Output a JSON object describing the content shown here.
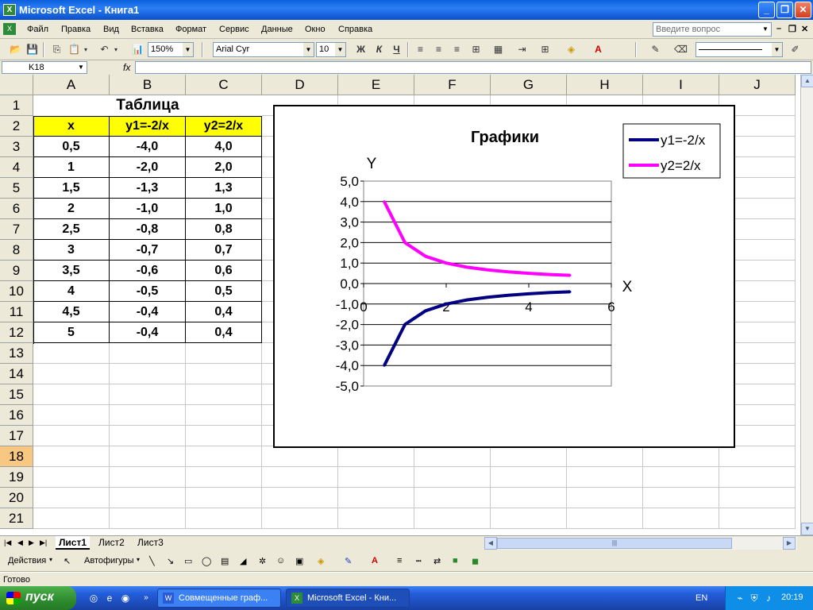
{
  "window": {
    "title": "Microsoft Excel - Книга1"
  },
  "menu": {
    "items": [
      "Файл",
      "Правка",
      "Вид",
      "Вставка",
      "Формат",
      "Сервис",
      "Данные",
      "Окно",
      "Справка"
    ],
    "ask_placeholder": "Введите вопрос"
  },
  "toolbar": {
    "zoom": "150%",
    "font": "Arial Cyr",
    "size": "10",
    "bold": "Ж",
    "italic": "К",
    "underline": "Ч"
  },
  "formula": {
    "namebox": "K18",
    "fx": "fx",
    "value": ""
  },
  "grid": {
    "columns": [
      "A",
      "B",
      "C",
      "D",
      "E",
      "F",
      "G",
      "H",
      "I",
      "J"
    ],
    "rows": [
      "1",
      "2",
      "3",
      "4",
      "5",
      "6",
      "7",
      "8",
      "9",
      "10",
      "11",
      "12",
      "13",
      "14",
      "15",
      "16",
      "17",
      "18",
      "19",
      "20",
      "21"
    ],
    "selected_row": "18",
    "table_title": "Таблица",
    "headers": [
      "x",
      "y1=-2/x",
      "y2=2/x"
    ],
    "data": [
      [
        "0,5",
        "-4,0",
        "4,0"
      ],
      [
        "1",
        "-2,0",
        "2,0"
      ],
      [
        "1,5",
        "-1,3",
        "1,3"
      ],
      [
        "2",
        "-1,0",
        "1,0"
      ],
      [
        "2,5",
        "-0,8",
        "0,8"
      ],
      [
        "3",
        "-0,7",
        "0,7"
      ],
      [
        "3,5",
        "-0,6",
        "0,6"
      ],
      [
        "4",
        "-0,5",
        "0,5"
      ],
      [
        "4,5",
        "-0,4",
        "0,4"
      ],
      [
        "5",
        "-0,4",
        "0,4"
      ]
    ]
  },
  "chart_data": {
    "type": "line",
    "title": "Графики",
    "xlabel": "X",
    "ylabel": "Y",
    "xlim": [
      0,
      6
    ],
    "ylim": [
      -5,
      5
    ],
    "xticks": [
      "0",
      "2",
      "4",
      "6"
    ],
    "yticks": [
      "5,0",
      "4,0",
      "3,0",
      "2,0",
      "1,0",
      "0,0",
      "-1,0",
      "-2,0",
      "-3,0",
      "-4,0",
      "-5,0"
    ],
    "grid": true,
    "legend": "top-right",
    "x": [
      0.5,
      1,
      1.5,
      2,
      2.5,
      3,
      3.5,
      4,
      4.5,
      5
    ],
    "series": [
      {
        "name": "y1=-2/x",
        "color": "#000080",
        "values": [
          -4.0,
          -2.0,
          -1.33,
          -1.0,
          -0.8,
          -0.67,
          -0.57,
          -0.5,
          -0.44,
          -0.4
        ]
      },
      {
        "name": "y2=2/x",
        "color": "#ff00ff",
        "values": [
          4.0,
          2.0,
          1.33,
          1.0,
          0.8,
          0.67,
          0.57,
          0.5,
          0.44,
          0.4
        ]
      }
    ]
  },
  "sheets": {
    "tabs": [
      "Лист1",
      "Лист2",
      "Лист3"
    ],
    "active": "Лист1"
  },
  "drawbar": {
    "actions": "Действия",
    "autoshapes": "Автофигуры"
  },
  "status": {
    "text": "Готово"
  },
  "taskbar": {
    "start": "пуск",
    "tasks": [
      "Совмещенные граф...",
      "Microsoft Excel - Кни..."
    ],
    "lang": "EN",
    "clock": "20:19"
  }
}
